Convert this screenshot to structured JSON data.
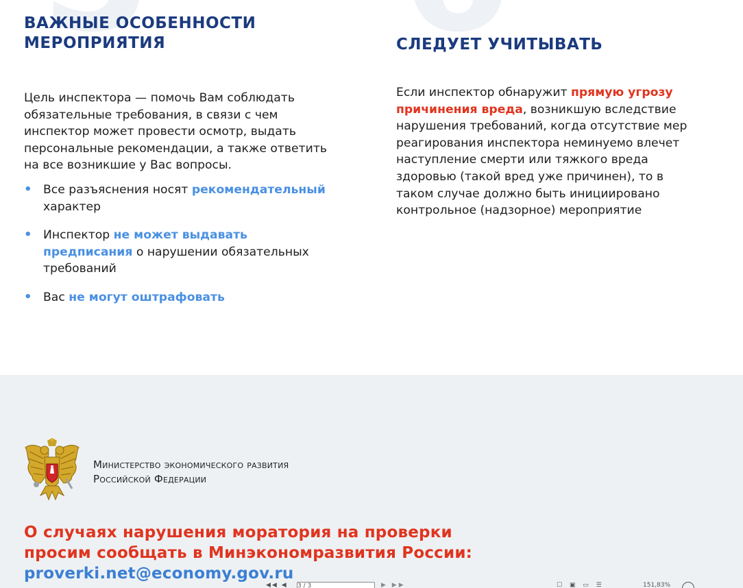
{
  "background_digits": {
    "left": "5",
    "right": "6"
  },
  "left_column": {
    "title_line1": "Важные особенности",
    "title_line2": "мероприятия",
    "paragraph": "Цель инспектора — помочь Вам соблюдать обязательные требования, в связи с чем инспектор может провести осмотр, выдать персональные рекомендации, а также ответить на все возникшие у Вас вопросы.",
    "bullets": [
      {
        "pre": "Все разъяснения носят ",
        "highlight": "рекомендательный",
        "post": " характер"
      },
      {
        "pre": "Инспектор ",
        "highlight": "не может выдавать предписания",
        "post": " о нарушении обязательных требований"
      },
      {
        "pre": "Вас ",
        "highlight": "не могут оштрафовать",
        "post": ""
      }
    ]
  },
  "right_column": {
    "title": "Следует учитывать",
    "para_pre": "Если инспектор обнаружит ",
    "para_highlight": "прямую угрозу причинения вреда",
    "para_post": ", возникшую вследствие нарушения требований, когда отсутствие мер реагирования инспектора неминуемо влечет наступление смерти или тяжкого вреда здоровью (такой вред уже причинен), то в таком случае должно быть инициировано контрольное (надзорное) мероприятие"
  },
  "footer": {
    "ministry_line1": "Министерство экономического развития",
    "ministry_line2": "Российской Федерации",
    "cta_line1": "О случаях нарушения моратория на проверки",
    "cta_line2": "просим сообщать в Минэкономразвития России:",
    "email": "proverki.net@economy.gov.ru"
  },
  "pdf_toolbar": {
    "nav_icons": "◀◀ ◀",
    "page_field": "3 / 3",
    "next_icons": "▶ ▶▶",
    "view_icons": "☐ ▣ ▭ ☰",
    "zoom": "151,83%"
  },
  "colors": {
    "heading": "#1b3b7f",
    "blue_highlight": "#4a90e2",
    "red_highlight": "#e0341f",
    "footer_bg": "#eef1f3"
  }
}
